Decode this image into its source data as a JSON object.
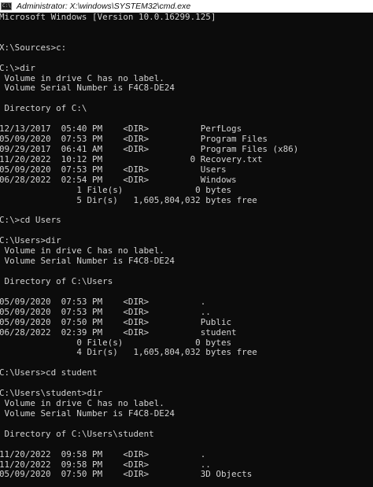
{
  "window": {
    "title": "Administrator: X:\\windows\\SYSTEM32\\cmd.exe",
    "icon": "cmd-console-icon"
  },
  "colors": {
    "background": "#0c0c0c",
    "text": "#d2d2d2",
    "titlebar": "#ffffff"
  },
  "console": {
    "lines": [
      "Microsoft Windows [Version 10.0.16299.125]",
      "",
      "",
      "X:\\Sources>c:",
      "",
      "C:\\>dir",
      " Volume in drive C has no label.",
      " Volume Serial Number is F4C8-DE24",
      "",
      " Directory of C:\\",
      "",
      "12/13/2017  05:40 PM    <DIR>          PerfLogs",
      "05/09/2020  07:53 PM    <DIR>          Program Files",
      "09/29/2017  06:41 AM    <DIR>          Program Files (x86)",
      "11/20/2022  10:12 PM                 0 Recovery.txt",
      "05/09/2020  07:53 PM    <DIR>          Users",
      "06/28/2022  02:54 PM    <DIR>          Windows",
      "               1 File(s)              0 bytes",
      "               5 Dir(s)   1,605,804,032 bytes free",
      "",
      "C:\\>cd Users",
      "",
      "C:\\Users>dir",
      " Volume in drive C has no label.",
      " Volume Serial Number is F4C8-DE24",
      "",
      " Directory of C:\\Users",
      "",
      "05/09/2020  07:53 PM    <DIR>          .",
      "05/09/2020  07:53 PM    <DIR>          ..",
      "05/09/2020  07:50 PM    <DIR>          Public",
      "06/28/2022  02:39 PM    <DIR>          student",
      "               0 File(s)              0 bytes",
      "               4 Dir(s)   1,605,804,032 bytes free",
      "",
      "C:\\Users>cd student",
      "",
      "C:\\Users\\student>dir",
      " Volume in drive C has no label.",
      " Volume Serial Number is F4C8-DE24",
      "",
      " Directory of C:\\Users\\student",
      "",
      "11/20/2022  09:58 PM    <DIR>          .",
      "11/20/2022  09:58 PM    <DIR>          ..",
      "05/09/2020  07:50 PM    <DIR>          3D Objects"
    ]
  }
}
